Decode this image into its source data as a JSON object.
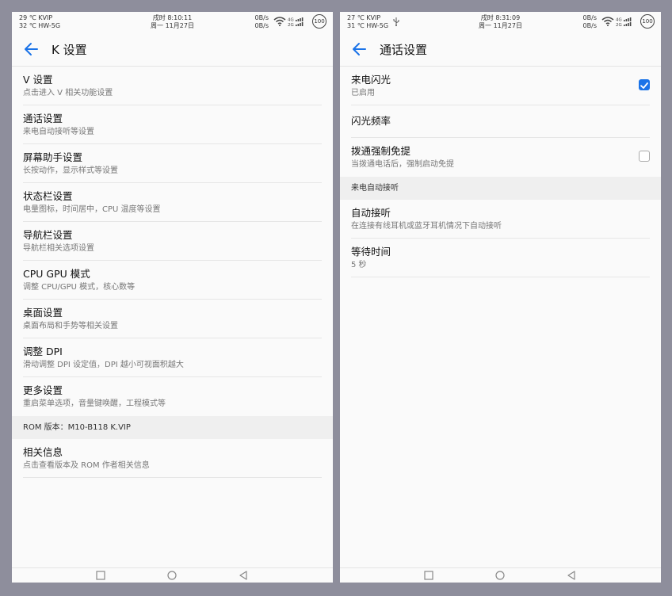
{
  "left": {
    "status": {
      "line1": "29 ℃ KVIP",
      "line2": "32 ℃ HW-5G",
      "time": "戌时 8:10:11",
      "date": "周一 11月27日",
      "speed_up": "0B/s",
      "speed_down": "0B/s",
      "net_top": "4G",
      "net_bottom": "2G",
      "battery": "100"
    },
    "title": "K 设置",
    "items": [
      {
        "title": "V 设置",
        "sub": "点击进入 V 相关功能设置"
      },
      {
        "title": "通话设置",
        "sub": "来电自动接听等设置"
      },
      {
        "title": "屏幕助手设置",
        "sub": "长按动作，显示样式等设置"
      },
      {
        "title": "状态栏设置",
        "sub": "电量图标，时间居中，CPU 温度等设置"
      },
      {
        "title": "导航栏设置",
        "sub": "导航栏相关选项设置"
      },
      {
        "title": "CPU GPU 模式",
        "sub": "调整 CPU/GPU 模式，核心数等"
      },
      {
        "title": "桌面设置",
        "sub": "桌面布局和手势等相关设置"
      },
      {
        "title": "调整 DPI",
        "sub": "滑动调整 DPI 设定值，DPI 越小可视面积越大"
      },
      {
        "title": "更多设置",
        "sub": "重启菜单选项，音量键唤醒，工程模式等"
      }
    ],
    "section_rom": "ROM 版本：M10-B118 K.VIP",
    "about": {
      "title": "相关信息",
      "sub": "点击查看版本及 ROM 作者相关信息"
    }
  },
  "right": {
    "status": {
      "line1": "27 ℃ KVIP",
      "line2": "31 ℃ HW-5G",
      "time": "戌时 8:31:09",
      "date": "周一 11月27日",
      "speed_up": "0B/s",
      "speed_down": "0B/s",
      "net_top": "4G",
      "net_bottom": "2G",
      "battery": "100"
    },
    "title": "通话设置",
    "flash": {
      "title": "来电闪光",
      "sub": "已启用",
      "checked": true
    },
    "flash_freq": {
      "title": "闪光频率"
    },
    "force_speaker": {
      "title": "拨通强制免提",
      "sub": "当拨通电话后，强制启动免提",
      "checked": false
    },
    "section_auto": "来电自动接听",
    "auto_answer": {
      "title": "自动接听",
      "sub": "在连接有线耳机或蓝牙耳机情况下自动接听"
    },
    "wait_time": {
      "title": "等待时间",
      "sub": "5 秒"
    }
  },
  "colors": {
    "accent": "#1a73e8",
    "background": "#8e8e9c",
    "panel": "#fafafa"
  },
  "icons": [
    "back-arrow-icon",
    "wifi-icon",
    "signal-icon",
    "battery-icon",
    "usb-icon",
    "check-icon",
    "nav-square-icon",
    "nav-home-icon",
    "nav-back-icon"
  ]
}
